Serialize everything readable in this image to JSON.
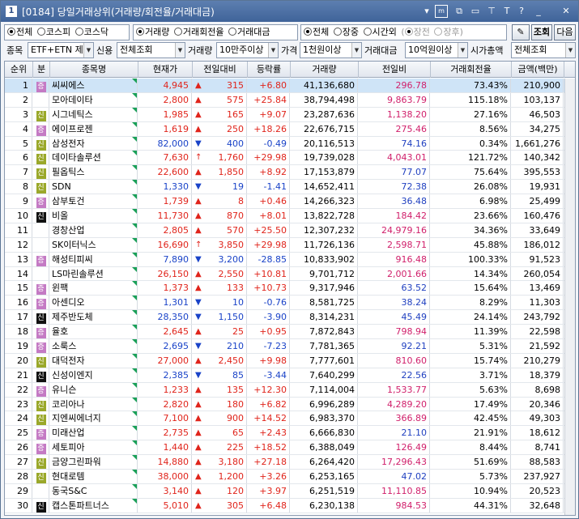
{
  "window": {
    "screen_no": "1",
    "title": "[0184] 당일거래상위(거래량/회전율/거래대금)"
  },
  "titlebar_icons": [
    "menu-dropdown-icon",
    "m-box-icon",
    "link-icon",
    "split-icon",
    "pin-icon",
    "font-icon",
    "help-icon",
    "minimize-icon",
    "close-icon"
  ],
  "filters": {
    "market": {
      "all": "전체",
      "kospi": "코스피",
      "kosdaq": "코스닥"
    },
    "sort": {
      "volume": "거래량",
      "turnover": "거래회전율",
      "amount": "거래대금"
    },
    "session": {
      "all": "전체",
      "regular": "장중",
      "afterhours": "시간외",
      "pre": "장전",
      "post": "장후"
    },
    "query_button": "조회",
    "next_button": "다음"
  },
  "conditions": {
    "stock_label": "종목",
    "stock_value": "ETF+ETN 제",
    "credit_label": "신용",
    "credit_value": "전체조회",
    "volume_label": "거래량",
    "volume_value": "10만주이상",
    "price_label": "가격",
    "price_value": "1천원이상",
    "amount_label": "거래대금",
    "amount_value": "10억원이상",
    "cap_label": "시가총액",
    "cap_value": "전체조회"
  },
  "table": {
    "headers": {
      "no": "순위",
      "mk": "분",
      "name": "종목명",
      "price": "현재가",
      "change": "전일대비",
      "rate": "등락률",
      "volume": "거래량",
      "prev": "전일비",
      "turnover": "거래회전율",
      "amount": "금액(백만)"
    },
    "rows": [
      {
        "no": "1",
        "mk": "kq",
        "name": "씨씨에스",
        "price": "4,945",
        "dir": "up",
        "change": "315",
        "rate": "+6.80",
        "volume": "41,136,680",
        "prev": "296.78",
        "pd": "up",
        "turnover": "73.43%",
        "amount": "210,900"
      },
      {
        "no": "2",
        "mk": "",
        "name": "모아데이타",
        "price": "2,800",
        "dir": "up",
        "change": "575",
        "rate": "+25.84",
        "volume": "38,794,498",
        "prev": "9,863.79",
        "pd": "up",
        "turnover": "115.18%",
        "amount": "103,137"
      },
      {
        "no": "3",
        "mk": "cr",
        "name": "시그네틱스",
        "price": "1,985",
        "dir": "up",
        "change": "165",
        "rate": "+9.07",
        "volume": "23,287,636",
        "prev": "1,138.20",
        "pd": "up",
        "turnover": "27.16%",
        "amount": "46,503"
      },
      {
        "no": "4",
        "mk": "kq",
        "name": "에이프로젠",
        "price": "1,619",
        "dir": "up",
        "change": "250",
        "rate": "+18.26",
        "volume": "22,676,715",
        "prev": "275.46",
        "pd": "up",
        "turnover": "8.56%",
        "amount": "34,275"
      },
      {
        "no": "5",
        "mk": "cr",
        "name": "삼성전자",
        "price": "82,000",
        "dir": "dn",
        "change": "400",
        "rate": "-0.49",
        "volume": "20,116,513",
        "prev": "74.16",
        "pd": "dn",
        "turnover": "0.34%",
        "amount": "1,661,276"
      },
      {
        "no": "6",
        "mk": "cr",
        "name": "데이타솔루션",
        "price": "7,630",
        "dir": "lim",
        "change": "1,760",
        "rate": "+29.98",
        "volume": "19,739,028",
        "prev": "4,043.01",
        "pd": "up",
        "turnover": "121.72%",
        "amount": "140,342"
      },
      {
        "no": "7",
        "mk": "cr",
        "name": "필옵틱스",
        "price": "22,600",
        "dir": "up",
        "change": "1,850",
        "rate": "+8.92",
        "volume": "17,153,879",
        "prev": "77.07",
        "pd": "dn",
        "turnover": "75.64%",
        "amount": "395,553"
      },
      {
        "no": "8",
        "mk": "cr",
        "name": "SDN",
        "price": "1,330",
        "dir": "dn",
        "change": "19",
        "rate": "-1.41",
        "volume": "14,652,411",
        "prev": "72.38",
        "pd": "dn",
        "turnover": "26.08%",
        "amount": "19,931"
      },
      {
        "no": "9",
        "mk": "kq",
        "name": "삼부토건",
        "price": "1,739",
        "dir": "up",
        "change": "8",
        "rate": "+0.46",
        "volume": "14,266,323",
        "prev": "36.48",
        "pd": "dn",
        "turnover": "6.98%",
        "amount": "25,499"
      },
      {
        "no": "10",
        "mk": "mg",
        "name": "비올",
        "price": "11,730",
        "dir": "up",
        "change": "870",
        "rate": "+8.01",
        "volume": "13,822,728",
        "prev": "184.42",
        "pd": "up",
        "turnover": "23.66%",
        "amount": "160,476"
      },
      {
        "no": "11",
        "mk": "",
        "name": "경창산업",
        "price": "2,805",
        "dir": "up",
        "change": "570",
        "rate": "+25.50",
        "volume": "12,307,232",
        "prev": "24,979.16",
        "pd": "up",
        "turnover": "34.36%",
        "amount": "33,649"
      },
      {
        "no": "12",
        "mk": "",
        "name": "SK이터닉스",
        "price": "16,690",
        "dir": "lim",
        "change": "3,850",
        "rate": "+29.98",
        "volume": "11,726,136",
        "prev": "2,598.71",
        "pd": "up",
        "turnover": "45.88%",
        "amount": "186,012"
      },
      {
        "no": "13",
        "mk": "kq",
        "name": "해성티피씨",
        "price": "7,890",
        "dir": "dn",
        "change": "3,200",
        "rate": "-28.85",
        "volume": "10,833,902",
        "prev": "916.48",
        "pd": "up",
        "turnover": "100.33%",
        "amount": "91,523"
      },
      {
        "no": "14",
        "mk": "",
        "name": "LS마린솔루션",
        "price": "26,150",
        "dir": "up",
        "change": "2,550",
        "rate": "+10.81",
        "volume": "9,701,712",
        "prev": "2,001.66",
        "pd": "up",
        "turnover": "14.34%",
        "amount": "260,054"
      },
      {
        "no": "15",
        "mk": "kq",
        "name": "윈팩",
        "price": "1,373",
        "dir": "up",
        "change": "133",
        "rate": "+10.73",
        "volume": "9,317,946",
        "prev": "63.52",
        "pd": "dn",
        "turnover": "15.64%",
        "amount": "13,469"
      },
      {
        "no": "16",
        "mk": "kq",
        "name": "아센디오",
        "price": "1,301",
        "dir": "dn",
        "change": "10",
        "rate": "-0.76",
        "volume": "8,581,725",
        "prev": "38.24",
        "pd": "dn",
        "turnover": "8.29%",
        "amount": "11,303"
      },
      {
        "no": "17",
        "mk": "mg",
        "name": "제주반도체",
        "price": "28,350",
        "dir": "dn",
        "change": "1,150",
        "rate": "-3.90",
        "volume": "8,314,231",
        "prev": "45.49",
        "pd": "dn",
        "turnover": "24.14%",
        "amount": "243,792"
      },
      {
        "no": "18",
        "mk": "kq",
        "name": "율호",
        "price": "2,645",
        "dir": "up",
        "change": "25",
        "rate": "+0.95",
        "volume": "7,872,843",
        "prev": "798.94",
        "pd": "up",
        "turnover": "11.39%",
        "amount": "22,598"
      },
      {
        "no": "19",
        "mk": "kq",
        "name": "소룩스",
        "price": "2,695",
        "dir": "dn",
        "change": "210",
        "rate": "-7.23",
        "volume": "7,781,365",
        "prev": "92.21",
        "pd": "dn",
        "turnover": "5.31%",
        "amount": "21,592"
      },
      {
        "no": "20",
        "mk": "cr",
        "name": "대덕전자",
        "price": "27,000",
        "dir": "up",
        "change": "2,450",
        "rate": "+9.98",
        "volume": "7,777,601",
        "prev": "810.60",
        "pd": "up",
        "turnover": "15.74%",
        "amount": "210,279"
      },
      {
        "no": "21",
        "mk": "mg",
        "name": "신성이엔지",
        "price": "2,385",
        "dir": "dn",
        "change": "85",
        "rate": "-3.44",
        "volume": "7,640,299",
        "prev": "22.56",
        "pd": "dn",
        "turnover": "3.71%",
        "amount": "18,379"
      },
      {
        "no": "22",
        "mk": "kq",
        "name": "유니슨",
        "price": "1,233",
        "dir": "up",
        "change": "135",
        "rate": "+12.30",
        "volume": "7,114,004",
        "prev": "1,533.77",
        "pd": "up",
        "turnover": "5.63%",
        "amount": "8,698"
      },
      {
        "no": "23",
        "mk": "cr",
        "name": "코리아나",
        "price": "2,820",
        "dir": "up",
        "change": "180",
        "rate": "+6.82",
        "volume": "6,996,289",
        "prev": "4,289.20",
        "pd": "up",
        "turnover": "17.49%",
        "amount": "20,346"
      },
      {
        "no": "24",
        "mk": "cr",
        "name": "지엔씨에너지",
        "price": "7,100",
        "dir": "up",
        "change": "900",
        "rate": "+14.52",
        "volume": "6,983,370",
        "prev": "366.89",
        "pd": "up",
        "turnover": "42.45%",
        "amount": "49,303"
      },
      {
        "no": "25",
        "mk": "kq",
        "name": "미래산업",
        "price": "2,735",
        "dir": "up",
        "change": "65",
        "rate": "+2.43",
        "volume": "6,666,830",
        "prev": "21.10",
        "pd": "dn",
        "turnover": "21.91%",
        "amount": "18,612"
      },
      {
        "no": "26",
        "mk": "kq",
        "name": "세토피아",
        "price": "1,440",
        "dir": "up",
        "change": "225",
        "rate": "+18.52",
        "volume": "6,388,049",
        "prev": "126.49",
        "pd": "up",
        "turnover": "8.44%",
        "amount": "8,741"
      },
      {
        "no": "27",
        "mk": "cr",
        "name": "금양그린파워",
        "price": "14,880",
        "dir": "up",
        "change": "3,180",
        "rate": "+27.18",
        "volume": "6,264,420",
        "prev": "17,296.43",
        "pd": "up",
        "turnover": "51.69%",
        "amount": "88,583"
      },
      {
        "no": "28",
        "mk": "cr",
        "name": "현대로템",
        "price": "38,000",
        "dir": "up",
        "change": "1,200",
        "rate": "+3.26",
        "volume": "6,253,165",
        "prev": "47.02",
        "pd": "dn",
        "turnover": "5.73%",
        "amount": "237,927"
      },
      {
        "no": "29",
        "mk": "",
        "name": "동국S&C",
        "price": "3,140",
        "dir": "up",
        "change": "120",
        "rate": "+3.97",
        "volume": "6,251,519",
        "prev": "11,110.85",
        "pd": "up",
        "turnover": "10.94%",
        "amount": "20,523"
      },
      {
        "no": "30",
        "mk": "mg",
        "name": "캡스톤파트너스",
        "price": "5,010",
        "dir": "up",
        "change": "305",
        "rate": "+6.48",
        "volume": "6,230,138",
        "prev": "984.53",
        "pd": "up",
        "turnover": "44.31%",
        "amount": "32,648"
      }
    ]
  },
  "badges": {
    "kq": "증",
    "cr": "신",
    "mg": "신"
  },
  "arrows": {
    "up": "▲",
    "dn": "▼",
    "lim": "↑"
  },
  "colors": {
    "up": "#e0241b",
    "down": "#1a43c8",
    "title_bar": "#3f6399",
    "selected_row": "#cfe4f7"
  }
}
